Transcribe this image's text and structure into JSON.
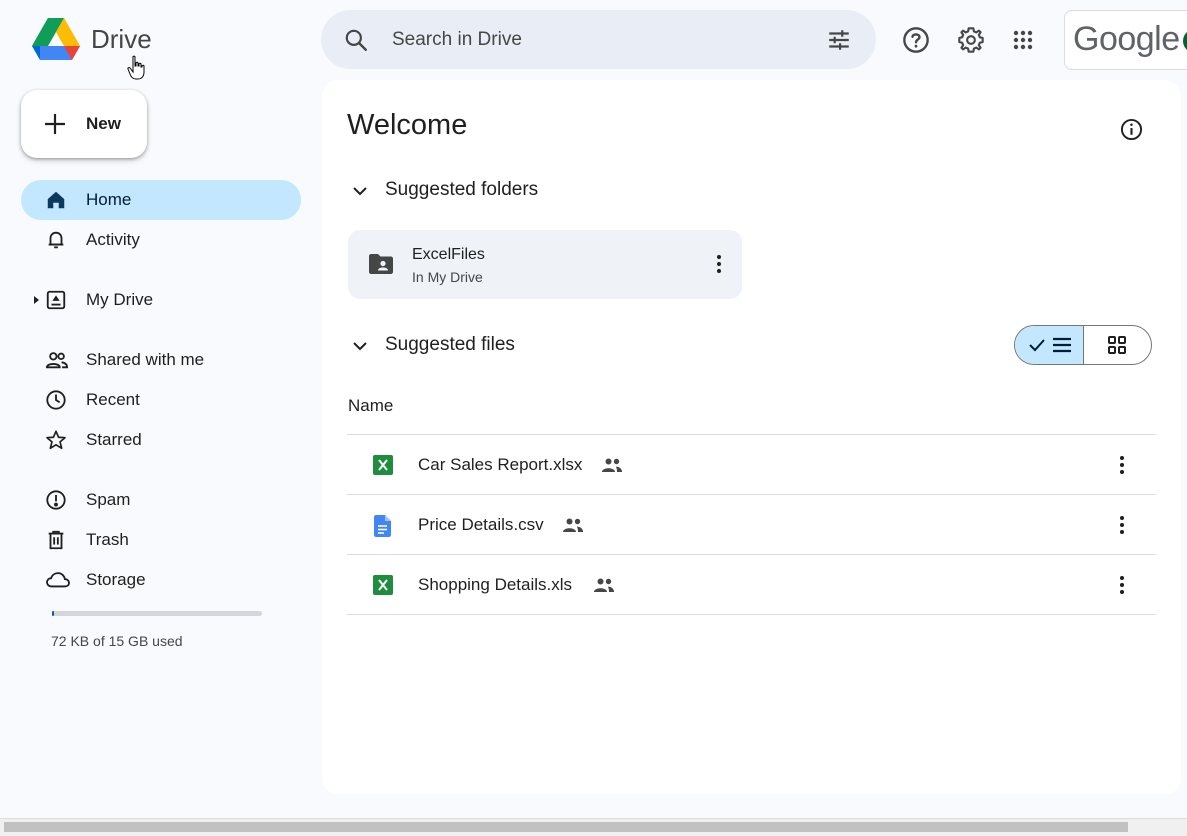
{
  "app": {
    "name": "Drive"
  },
  "search": {
    "placeholder": "Search in Drive"
  },
  "header": {
    "account_brand": "Google"
  },
  "new_button": {
    "label": "New"
  },
  "sidebar": {
    "items": [
      {
        "label": "Home",
        "icon": "home-icon",
        "active": true
      },
      {
        "label": "Activity",
        "icon": "bell-icon"
      },
      {
        "label": "My Drive",
        "icon": "my-drive-icon"
      },
      {
        "label": "Shared with me",
        "icon": "people-icon"
      },
      {
        "label": "Recent",
        "icon": "clock-icon"
      },
      {
        "label": "Starred",
        "icon": "star-icon"
      },
      {
        "label": "Spam",
        "icon": "spam-icon"
      },
      {
        "label": "Trash",
        "icon": "trash-icon"
      },
      {
        "label": "Storage",
        "icon": "cloud-icon"
      }
    ],
    "storage": {
      "used_text": "72 KB of 15 GB used",
      "used_fraction": 0.01
    }
  },
  "main": {
    "title": "Welcome",
    "suggested_folders": {
      "title": "Suggested folders",
      "folders": [
        {
          "name": "ExcelFiles",
          "location": "In My Drive"
        }
      ]
    },
    "suggested_files": {
      "title": "Suggested files",
      "column_name": "Name",
      "files": [
        {
          "name": "Car Sales Report.xlsx",
          "type": "excel",
          "shared": true
        },
        {
          "name": "Price Details.csv",
          "type": "doc",
          "shared": true
        },
        {
          "name": "Shopping Details.xls",
          "type": "excel",
          "shared": true
        }
      ]
    }
  },
  "colors": {
    "accent": "#c2e7ff",
    "search_bg": "#e9eef6",
    "excel_green": "#1e8e3e",
    "doc_blue": "#4285f4"
  }
}
